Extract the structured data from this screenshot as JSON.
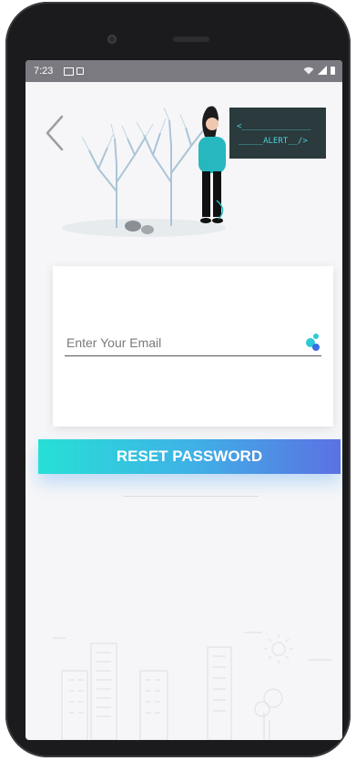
{
  "status_bar": {
    "time": "7:23",
    "icons": [
      "image-icon",
      "record-icon",
      "wifi-icon",
      "signal-icon",
      "battery-icon"
    ]
  },
  "illustration": {
    "alert_code_line1": "<______________",
    "alert_code_line2": "_____ALERT__/>"
  },
  "form": {
    "email_placeholder": "Enter Your Email",
    "email_value": ""
  },
  "actions": {
    "reset_label": "RESET PASSWORD"
  },
  "colors": {
    "accent_start": "#26e0d6",
    "accent_end": "#5b71e3",
    "alert_bg": "#2a3a3d",
    "alert_text": "#4fd1d9"
  }
}
